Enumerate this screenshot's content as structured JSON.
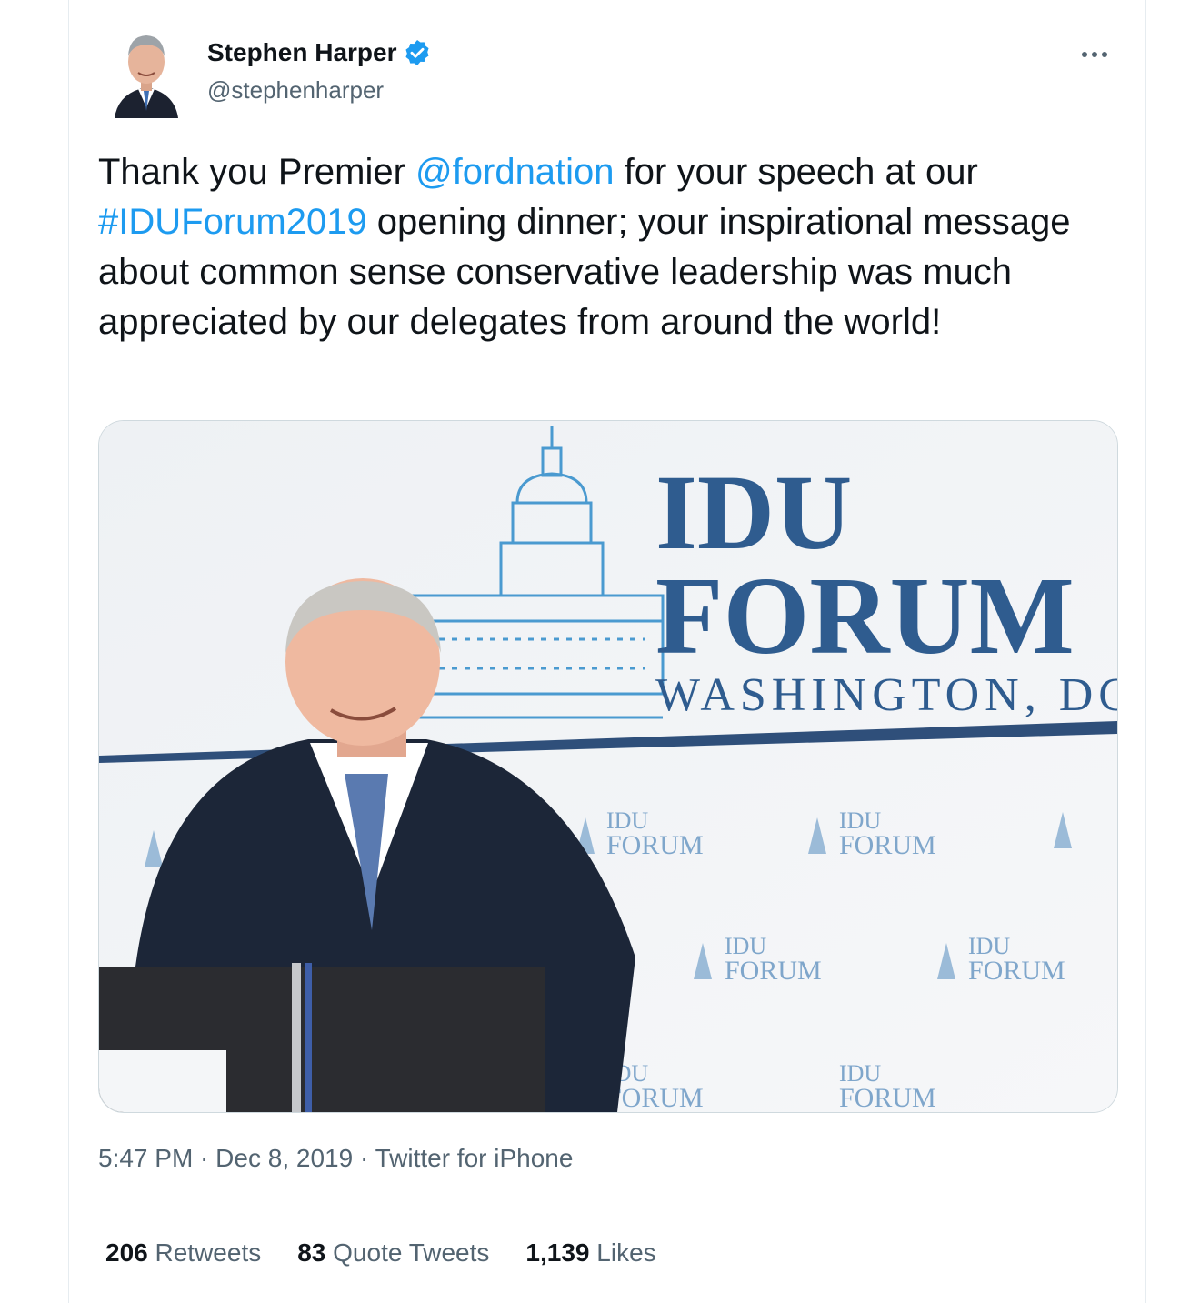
{
  "author": {
    "name": "Stephen Harper",
    "handle": "@stephenharper",
    "verified": true
  },
  "icons": {
    "avatar": "avatar",
    "verified": "verified-badge-icon",
    "more": "more-options-icon"
  },
  "colors": {
    "link": "#1d9bf0",
    "text": "#0f1419",
    "muted": "#536471",
    "forum_blue": "#2f5c8f"
  },
  "tweet": {
    "text_part1": "Thank you Premier ",
    "mention": "@fordnation",
    "text_part2": " for your speech at our ",
    "hashtag": "#IDUForum2019",
    "text_part3": " opening dinner; your inspirational message about common sense conservative leadership was much appreciated by our delegates from around the world!"
  },
  "media": {
    "banner_line1": "IDU",
    "banner_line2": "FORUM",
    "banner_line3": "WASHINGTON, DC",
    "small_line1": "IDU",
    "small_line2": "FORUM"
  },
  "meta": {
    "time": "5:47 PM",
    "date": "Dec 8, 2019",
    "source": "Twitter for iPhone",
    "separator": " · "
  },
  "stats": {
    "retweets_count": "206",
    "retweets_label": "Retweets",
    "quotes_count": "83",
    "quotes_label": "Quote Tweets",
    "likes_count": "1,139",
    "likes_label": "Likes"
  }
}
